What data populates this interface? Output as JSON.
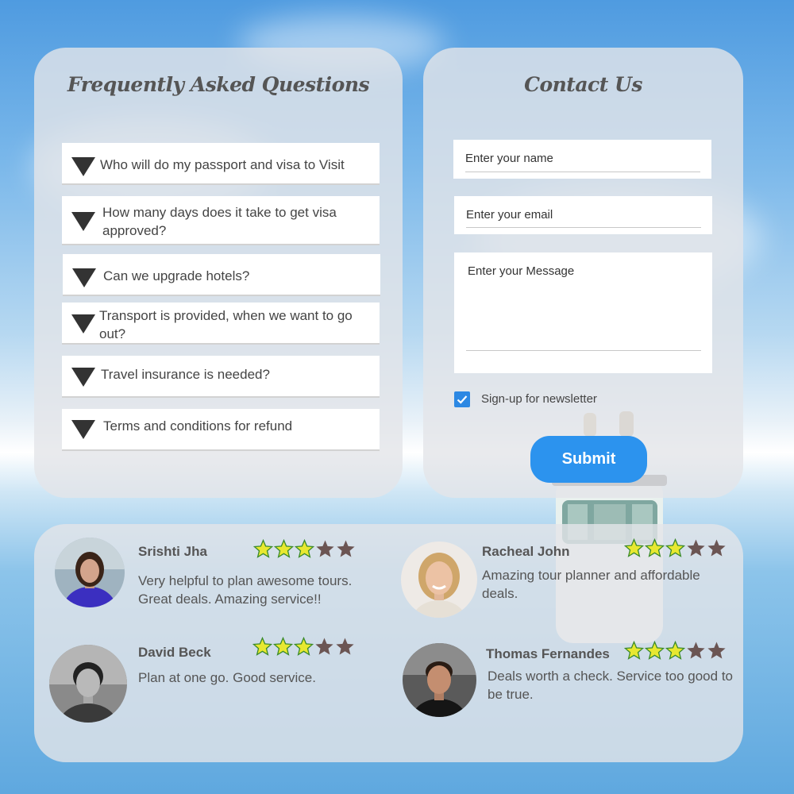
{
  "faq": {
    "title": "Frequently Asked Questions",
    "items": [
      {
        "question": "Who will do my passport and visa to Visit"
      },
      {
        "question": "How many days does it take to get visa approved?"
      },
      {
        "question": "Can we upgrade hotels?"
      },
      {
        "question": "Transport is provided, when we want to go out?"
      },
      {
        "question": "Travel insurance is needed?"
      },
      {
        "question": "Terms and conditions for refund"
      }
    ]
  },
  "contact": {
    "title": "Contact Us",
    "name_placeholder": "Enter your name",
    "email_placeholder": "Enter your email",
    "message_placeholder": "Enter your Message",
    "newsletter_label": "Sign-up for newsletter",
    "newsletter_checked": true,
    "submit_label": "Submit"
  },
  "reviews": [
    {
      "name": "Srishti Jha",
      "text": "Very helpful to plan awesome tours. Great deals. Amazing service!!",
      "rating": 3,
      "max_rating": 5
    },
    {
      "name": "Racheal John",
      "text": "Amazing tour planner and affordable deals.",
      "rating": 3,
      "max_rating": 5
    },
    {
      "name": "David Beck",
      "text": "Plan at one go. Good service.",
      "rating": 3,
      "max_rating": 5
    },
    {
      "name": "Thomas Fernandes",
      "text": "Deals worth a check. Service too good to be true.",
      "rating": 3,
      "max_rating": 5
    }
  ],
  "colors": {
    "accent": "#2c93ee",
    "star_filled": "#e8e830",
    "star_empty": "#6b5553",
    "panel": "#e4e5e8"
  }
}
